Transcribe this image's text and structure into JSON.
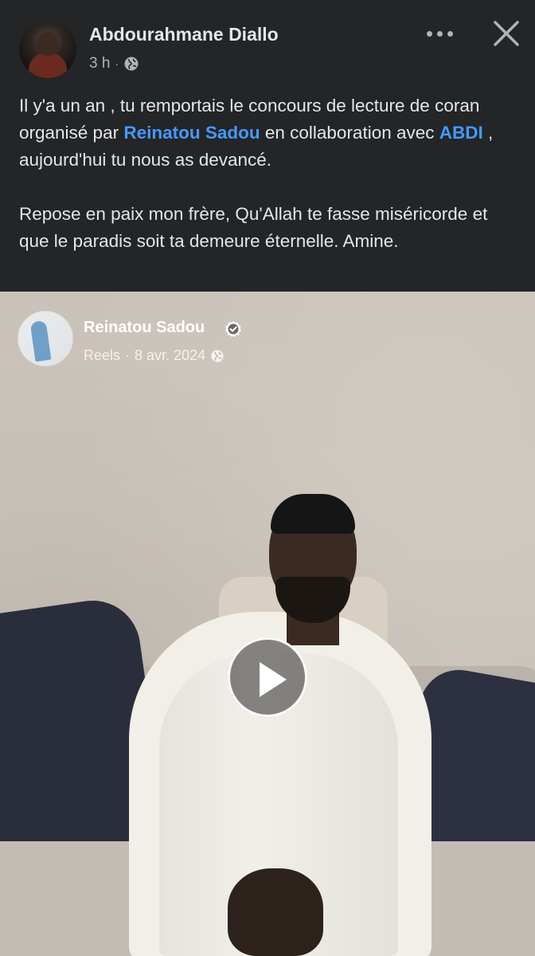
{
  "post": {
    "author": "Abdourahmane Diallo",
    "time": "3 h",
    "separator": "·",
    "text_p1_part1": "Il y'a un an , tu remportais le concours de lecture de coran organisé par ",
    "mention1": "Reinatou Sadou",
    "text_p1_part2": " en collaboration avec ",
    "mention2": "ABDI",
    "text_p1_part3": " , aujourd'hui tu nous as devancé.",
    "text_p2": "Repose en paix mon frère, Qu'Allah te fasse miséricorde et que le paradis soit ta demeure éternelle. Amine."
  },
  "shared": {
    "name": "Reinatou Sadou",
    "meta_type": "Reels",
    "separator": "·",
    "date": "8 avr. 2024"
  },
  "icons": {
    "privacy": "globe-icon",
    "more": "more-options-icon",
    "close": "close-icon",
    "verified": "verified-badge-icon",
    "play": "play-icon"
  },
  "colors": {
    "background": "#242526",
    "text": "#e4e6eb",
    "muted": "#b0b3b8",
    "mention": "#4599ff"
  }
}
